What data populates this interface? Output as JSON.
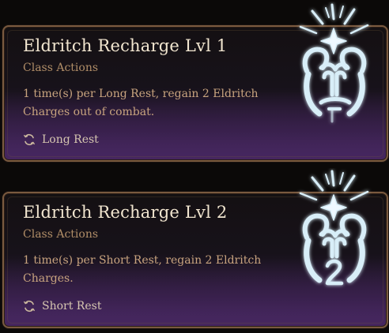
{
  "cards": [
    {
      "title": "Eldritch Recharge Lvl 1",
      "category": "Class Actions",
      "description": "1 time(s) per Long Rest, regain 2 Eldritch Charges out of combat.",
      "rest": {
        "icon": "refresh-icon",
        "label": "Long Rest"
      },
      "spell_icon": "eldritch-recharge-icon"
    },
    {
      "title": "Eldritch Recharge Lvl 2",
      "category": "Class Actions",
      "description": "1 time(s) per Short Rest, regain 2 Eldritch Charges.",
      "rest": {
        "icon": "refresh-icon",
        "label": "Short Rest"
      },
      "spell_icon": "eldritch-recharge-icon"
    }
  ],
  "colors": {
    "border": "#7a5a3f",
    "title": "#f2e6d0",
    "category": "#b08d67",
    "description": "#c9a47f",
    "rest_label": "#d6c6b0",
    "panel_bottom": "#452a5d",
    "icon_glow": "#cfe6f2"
  }
}
